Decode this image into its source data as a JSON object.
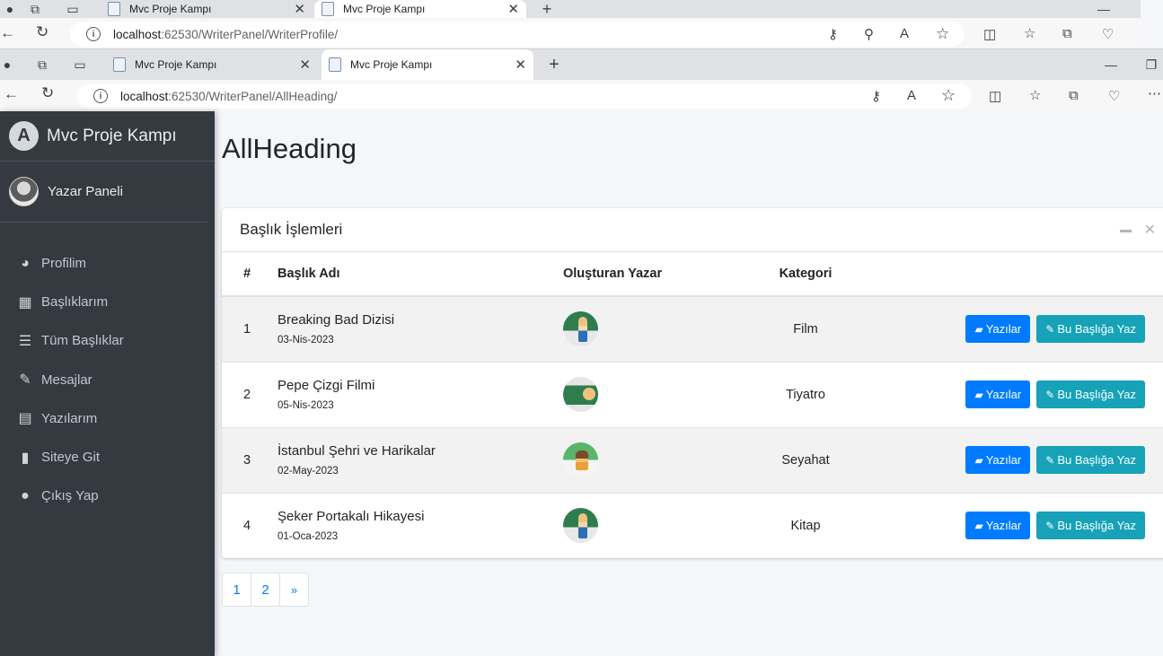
{
  "browser_back": {
    "tabs": [
      {
        "title": "Mvc Proje Kampı"
      },
      {
        "title": "Mvc Proje Kampı"
      }
    ],
    "url_host": "localhost",
    "url_path": ":62530/WriterPanel/WriterProfile/"
  },
  "browser_front": {
    "tabs": [
      {
        "title": "Mvc Proje Kampı"
      },
      {
        "title": "Mvc Proje Kampı"
      }
    ],
    "url_host": "localhost",
    "url_path": ":62530/WriterPanel/AllHeading/"
  },
  "sidebar": {
    "brand": "Mvc Proje Kampı",
    "user": "Yazar Paneli",
    "items": [
      {
        "label": "Profilim",
        "icon": "tachometer-icon"
      },
      {
        "label": "Başlıklarım",
        "icon": "grid-icon"
      },
      {
        "label": "Tüm Başlıklar",
        "icon": "list-icon"
      },
      {
        "label": "Mesajlar",
        "icon": "edit-icon"
      },
      {
        "label": "Yazılarım",
        "icon": "calendar-icon"
      },
      {
        "label": "Siteye Git",
        "icon": "book-icon"
      },
      {
        "label": "Çıkış Yap",
        "icon": "apple-icon"
      }
    ]
  },
  "page": {
    "title": "AllHeading"
  },
  "card": {
    "title": "Başlık İşlemleri",
    "columns": [
      "#",
      "Başlık Adı",
      "Oluşturan Yazar",
      "Kategori",
      ""
    ],
    "rows": [
      {
        "no": "1",
        "title": "Breaking Bad Dizisi",
        "date": "03-Nis-2023",
        "category": "Film"
      },
      {
        "no": "2",
        "title": "Pepe Çizgi Filmi",
        "date": "05-Nis-2023",
        "category": "Tiyatro"
      },
      {
        "no": "3",
        "title": "İstanbul Şehri ve Harikalar",
        "date": "02-May-2023",
        "category": "Seyahat"
      },
      {
        "no": "4",
        "title": "Şeker Portakalı Hikayesi",
        "date": "01-Oca-2023",
        "category": "Kitap"
      }
    ],
    "btn_posts": "Yazılar",
    "btn_write": "Bu Başlığa Yaz"
  },
  "pagination": [
    "1",
    "2",
    "»"
  ],
  "colors": {
    "sidebar_bg": "#343a40",
    "primary": "#007bff",
    "info": "#17a2b8"
  }
}
